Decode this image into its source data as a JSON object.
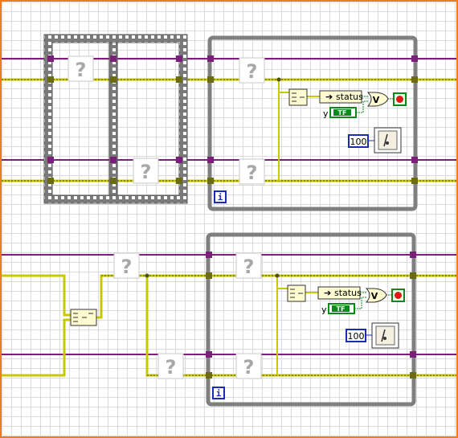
{
  "diagram": {
    "upper_section": {
      "while_loop": {
        "status_label": "status",
        "y_label": "y",
        "boolean_constant": "TF",
        "wait_ms": "100",
        "iteration_terminal": "i",
        "or_symbol": "V"
      }
    },
    "lower_section": {
      "while_loop": {
        "status_label": "status",
        "y_label": "y",
        "boolean_constant": "TF",
        "wait_ms": "100",
        "iteration_terminal": "i",
        "or_symbol": "V"
      }
    },
    "unknown_node_symbol": "?",
    "colors": {
      "error_wire": "#c8c800",
      "refnum_wire": "#7a1f7a",
      "loop_border": "#7f7f7f",
      "frame_border": "#6e6e6e",
      "numeric_border": "#1a2bb5",
      "boolean_green": "#0a8a1a",
      "stop_red": "#e01818"
    }
  }
}
